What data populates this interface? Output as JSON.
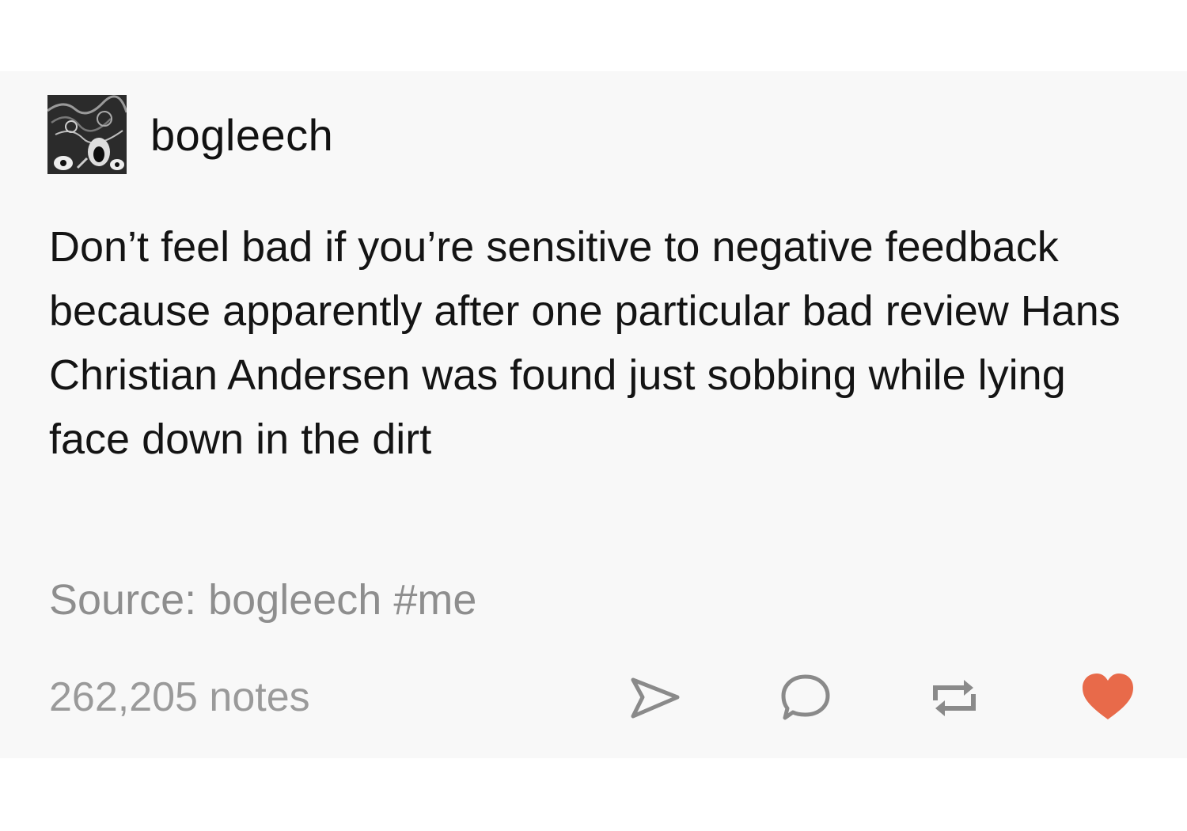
{
  "post": {
    "username": "bogleech",
    "body": "Don’t feel bad if you’re sensitive to negative feedback because apparently after one particular bad review Hans Christian Andersen was found just sobbing while lying face down in the dirt",
    "source_prefix": "Source:",
    "source_name": "bogleech",
    "tag": "#me",
    "notes": "262,205 notes"
  },
  "colors": {
    "card_background": "#f8f8f8",
    "text": "#141414",
    "muted_text": "#8e8e8e",
    "icon_gray": "#8a8a8a",
    "heart": "#e86a4a"
  },
  "icons": {
    "share": "paper-plane-icon",
    "reply": "speech-bubble-icon",
    "reblog": "reblog-arrows-icon",
    "like": "heart-icon"
  }
}
